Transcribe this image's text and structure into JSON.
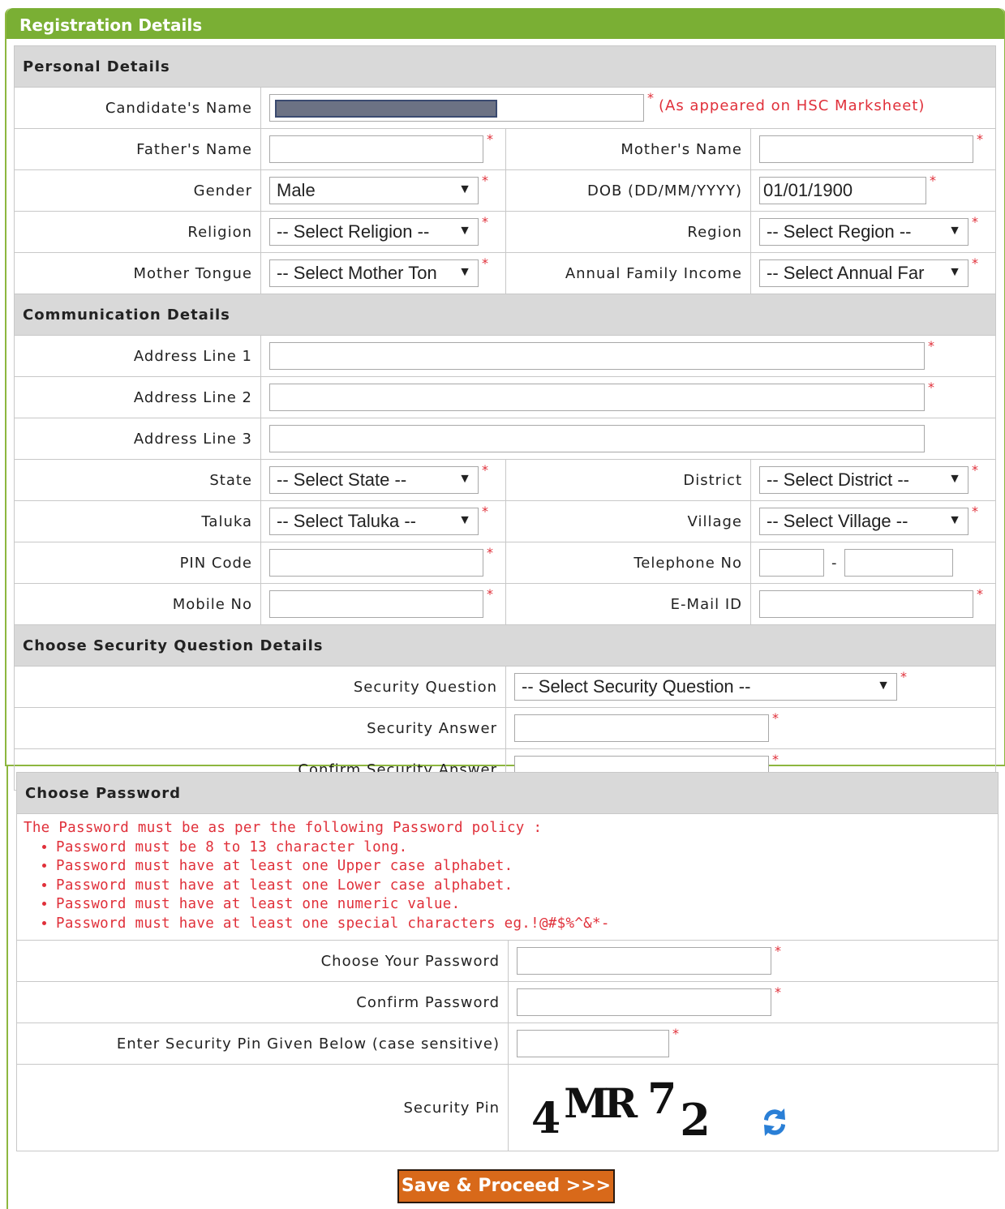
{
  "header": {
    "title": "Registration Details"
  },
  "sections": {
    "personal": "Personal Details",
    "communication": "Communication Details",
    "security": "Choose Security Question Details",
    "password": "Choose Password"
  },
  "fields": {
    "candidate_name": {
      "label": "Candidate's Name",
      "hint": "(As appeared on HSC Marksheet)"
    },
    "father_name": {
      "label": "Father's Name"
    },
    "mother_name": {
      "label": "Mother's Name"
    },
    "gender": {
      "label": "Gender",
      "value": "Male"
    },
    "dob": {
      "label": "DOB (DD/MM/YYYY)",
      "value": "01/01/1900"
    },
    "religion": {
      "label": "Religion",
      "value": "-- Select Religion --"
    },
    "region": {
      "label": "Region",
      "value": "-- Select Region --"
    },
    "mother_tongue": {
      "label": "Mother Tongue",
      "value": "-- Select Mother Ton"
    },
    "annual_income": {
      "label": "Annual Family Income",
      "value": "-- Select Annual Far"
    },
    "address1": {
      "label": "Address Line 1"
    },
    "address2": {
      "label": "Address Line 2"
    },
    "address3": {
      "label": "Address Line 3"
    },
    "state": {
      "label": "State",
      "value": "-- Select State --"
    },
    "district": {
      "label": "District",
      "value": "-- Select District --"
    },
    "taluka": {
      "label": "Taluka",
      "value": "-- Select Taluka --"
    },
    "village": {
      "label": "Village",
      "value": "-- Select Village --"
    },
    "pin": {
      "label": "PIN Code"
    },
    "telephone": {
      "label": "Telephone No",
      "separator": "-"
    },
    "mobile": {
      "label": "Mobile No"
    },
    "email": {
      "label": "E-Mail ID"
    },
    "security_question": {
      "label": "Security Question",
      "value": "-- Select Security Question --"
    },
    "security_answer": {
      "label": "Security Answer"
    },
    "confirm_security_answer": {
      "label": "Confirm Security Answer"
    },
    "password": {
      "label": "Choose Your Password"
    },
    "confirm_password": {
      "label": "Confirm Password"
    },
    "security_pin_input": {
      "label": "Enter Security Pin Given Below (case sensitive)"
    },
    "security_pin": {
      "label": "Security Pin"
    }
  },
  "password_policy": {
    "intro": "The Password must be as per the following Password policy :",
    "rules": [
      "Password must be 8 to 13 character long.",
      "Password must have at least one Upper case alphabet.",
      "Password must have at least one Lower case alphabet.",
      "Password must have at least one numeric value.",
      "Password must have at least one special characters eg.!@#$%^&*-"
    ]
  },
  "captcha": {
    "c1": "4",
    "c2": "MR",
    "c3": "7",
    "c4": "2"
  },
  "required_mark": "*",
  "select_arrow": "▼",
  "submit_label": "Save & Proceed >>>",
  "colors": {
    "header_green": "#7aaf34",
    "required_red": "#e0303a",
    "button_orange": "#d8691a",
    "refresh_blue": "#2a7fd6"
  },
  "icons": {
    "refresh": "refresh-icon"
  }
}
